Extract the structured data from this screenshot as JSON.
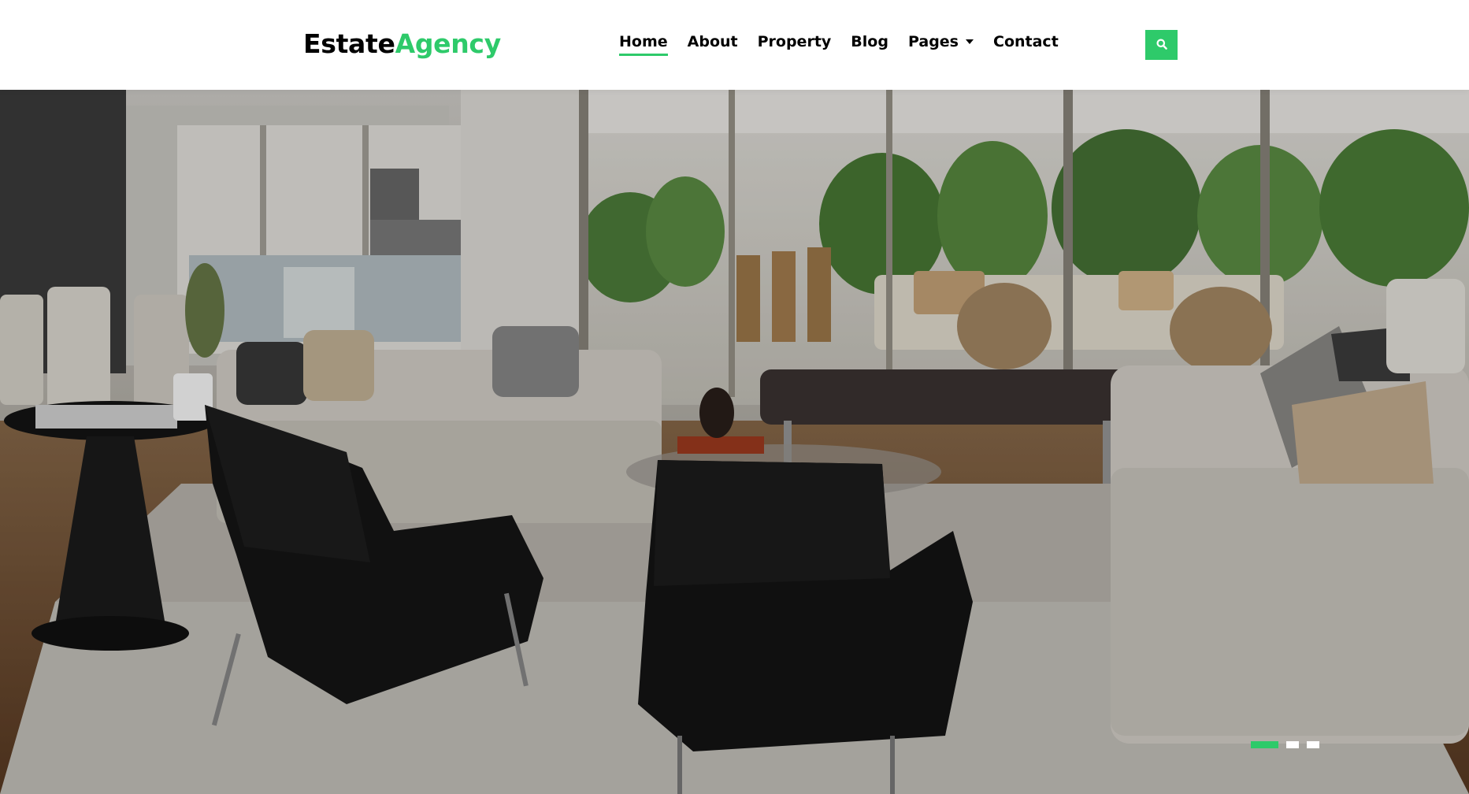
{
  "brand": {
    "part1": "Estate",
    "part2": "Agency"
  },
  "nav": {
    "items": [
      {
        "label": "Home",
        "active": true
      },
      {
        "label": "About",
        "active": false
      },
      {
        "label": "Property",
        "active": false
      },
      {
        "label": "Blog",
        "active": false
      },
      {
        "label": "Pages",
        "active": false,
        "has_dropdown": true
      },
      {
        "label": "Contact",
        "active": false
      }
    ]
  },
  "search": {
    "icon": "search-icon"
  },
  "hero": {
    "image": "living-room-photo",
    "slides_count": 3,
    "active_slide": 1
  },
  "colors": {
    "accent": "#2eca6a",
    "text": "#000000",
    "background": "#ffffff"
  }
}
